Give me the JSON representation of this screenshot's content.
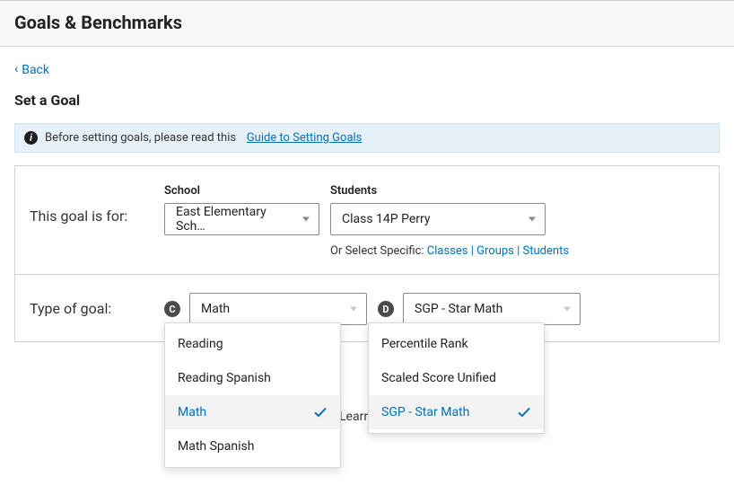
{
  "header": {
    "title": "Goals & Benchmarks"
  },
  "nav": {
    "back": "Back"
  },
  "subheader": "Set a Goal",
  "info": {
    "prefix": "Before setting goals, please read this",
    "link": "Guide to Setting Goals"
  },
  "row1": {
    "label": "This goal is for:",
    "school": {
      "label": "School",
      "value": "East Elementary Sch…"
    },
    "students": {
      "label": "Students",
      "value": "Class 14P Perry",
      "subtext_prefix": "Or Select Specific:",
      "links": {
        "classes": "Classes",
        "groups": "Groups",
        "students": "Students"
      }
    }
  },
  "row2": {
    "label": "Type of goal:",
    "badgeC": "C",
    "badgeD": "D",
    "subject_value": "Math",
    "metric_value": "SGP - Star Math",
    "menuC": {
      "items": [
        {
          "label": "Reading",
          "selected": false
        },
        {
          "label": "Reading Spanish",
          "selected": false
        },
        {
          "label": "Math",
          "selected": true
        },
        {
          "label": "Math Spanish",
          "selected": false
        }
      ]
    },
    "menuD": {
      "items": [
        {
          "label": "Percentile Rank",
          "selected": false
        },
        {
          "label": "Scaled Score Unified",
          "selected": false
        },
        {
          "label": "SGP - Star Math",
          "selected": true
        }
      ]
    }
  },
  "learn_fragment": "Learn"
}
